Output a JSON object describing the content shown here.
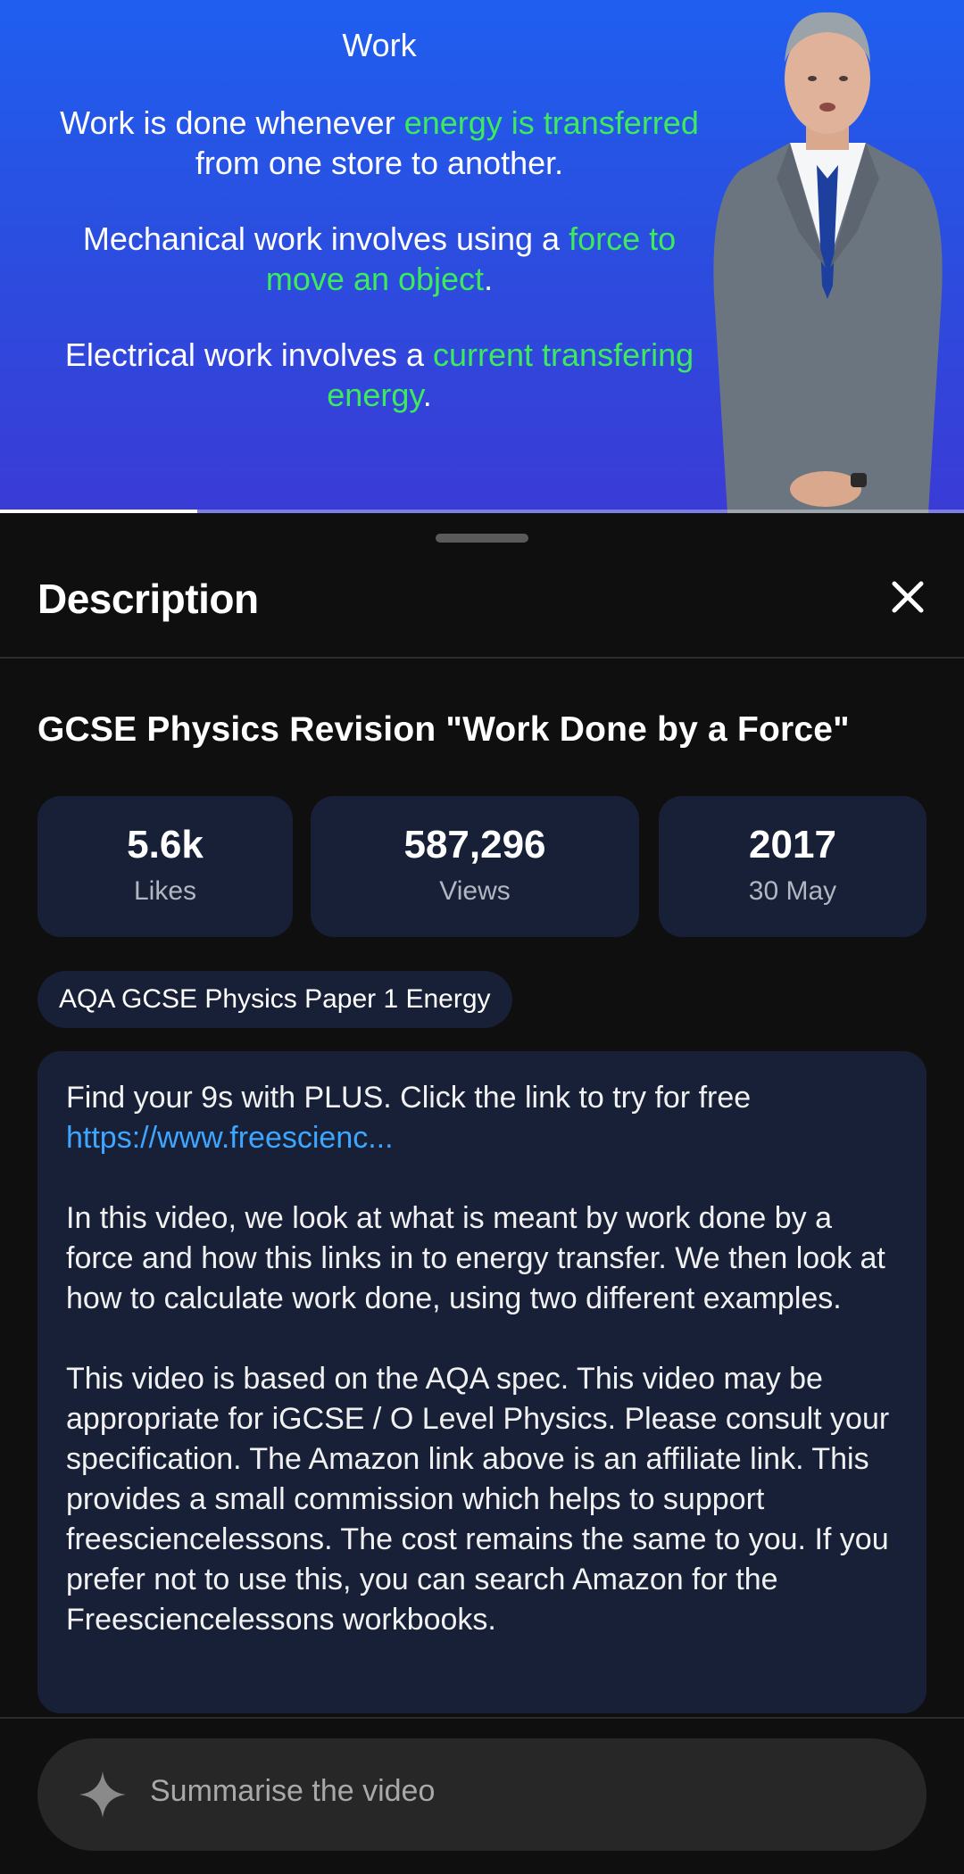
{
  "video": {
    "slide_title": "Work",
    "line1_a": "Work is done whenever ",
    "line1_green": "energy is transferred",
    "line1_b": " from one store to another.",
    "line2_a": "Mechanical work involves using a ",
    "line2_green": "force to move an object",
    "line2_b": ".",
    "line3_a": "Electrical work involves a ",
    "line3_green": "current transfering energy",
    "line3_b": ".",
    "progress_fraction": 0.205
  },
  "sheet": {
    "title": "Description",
    "close_icon": "close-icon"
  },
  "video_title": "GCSE Physics Revision \"Work Done by a Force\"",
  "stats": {
    "likes_value": "5.6k",
    "likes_label": "Likes",
    "views_value": "587,296",
    "views_label": "Views",
    "year_value": "2017",
    "date_label": "30 May"
  },
  "tag": "AQA GCSE Physics Paper 1 Energy",
  "description": {
    "p1": "Find your 9s with PLUS. Click the link to try for free",
    "link": "https://www.freescienc...",
    "p2": "In this video, we look at what is meant by work done by a force and how this links in to energy transfer. We then look at how to calculate work done, using two different examples.",
    "p3": "This video is based on the AQA spec. This video may be appropriate for iGCSE / O Level Physics. Please consult your specification. The Amazon link above is an affiliate link. This provides a small commission which helps to support freesciencelessons. The cost remains the same to you. If you prefer not to use this, you can search Amazon for the Freesciencelessons workbooks."
  },
  "ask": {
    "placeholder": "Summarise the video",
    "icon": "sparkle-icon"
  },
  "colors": {
    "accent_link": "#3ea6ff",
    "slide_green": "#3dea5e",
    "card_bg": "#172037"
  }
}
